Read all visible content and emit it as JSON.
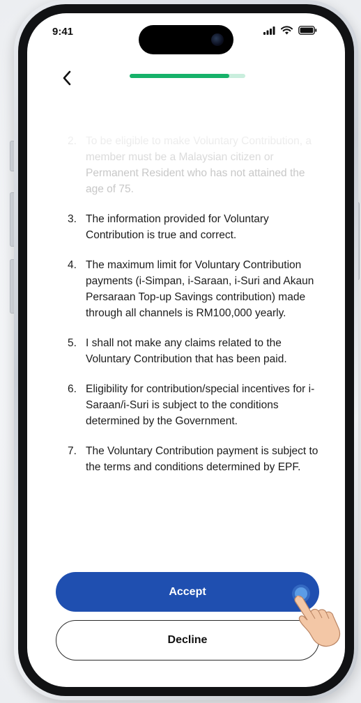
{
  "status_bar": {
    "time": "9:41"
  },
  "header": {
    "back_icon": "chevron-left-icon",
    "progress": 0.86,
    "progress_color": "#17b26a"
  },
  "terms": [
    {
      "number": "2.",
      "text": "To be eligible to make Voluntary Contribution, a member must be a Malaysian citizen or Permanent Resident who has not attained the age of 75."
    },
    {
      "number": "3.",
      "text": "The information provided for Voluntary Contribution is true and correct."
    },
    {
      "number": "4.",
      "text": "The maximum limit for Voluntary Contribution payments (i-Simpan, i-Saraan, i-Suri and Akaun Persaraan Top-up Savings contribution) made through all channels is RM100,000 yearly."
    },
    {
      "number": "5.",
      "text": "I shall not make any claims related to the Voluntary Contribution that has been paid."
    },
    {
      "number": "6.",
      "text": "Eligibility for contribution/special incentives for i-Saraan/i-Suri is subject to the conditions determined by the Government."
    },
    {
      "number": "7.",
      "text": "The Voluntary Contribution payment is subject to the terms and conditions determined by EPF."
    }
  ],
  "actions": {
    "accept_label": "Accept",
    "decline_label": "Decline",
    "accept_color": "#1f4fb0"
  },
  "overlay": {
    "tap_hint_icon": "pointing-hand-icon"
  }
}
